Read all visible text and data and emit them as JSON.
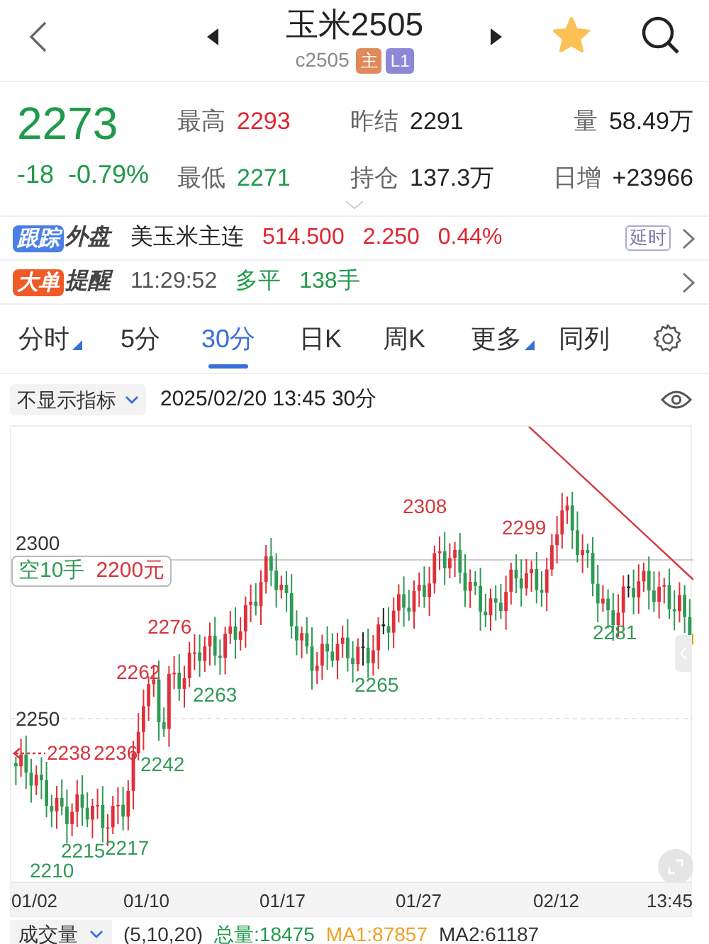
{
  "header": {
    "title": "玉米2505",
    "code": "c2505",
    "badges": [
      {
        "text": "主",
        "color": "#e0895a"
      },
      {
        "text": "L1",
        "color": "#8b89d6"
      }
    ],
    "favorite": true
  },
  "quote": {
    "price": "2273",
    "change": "-18",
    "change_pct": "-0.79%",
    "stats": [
      {
        "label": "最高",
        "value": "2293",
        "color": "#e0242f"
      },
      {
        "label": "昨结",
        "value": "2291",
        "color": "#222222"
      },
      {
        "label": "量",
        "value": "58.49万",
        "color": "#222222"
      },
      {
        "label": "最低",
        "value": "2271",
        "color": "#1f9a4a"
      },
      {
        "label": "持仓",
        "value": "137.3万",
        "color": "#222222"
      },
      {
        "label": "日增",
        "value": "+23966",
        "color": "#222222"
      }
    ]
  },
  "alerts": [
    {
      "tag": {
        "text": "跟踪",
        "color": "#4a7ee8"
      },
      "tag_suffix": "外盘",
      "badge": "延时",
      "items": [
        {
          "text": "美玉米主连",
          "color": "#222222"
        },
        {
          "text": "514.500",
          "color": "#e0242f"
        },
        {
          "text": "2.250",
          "color": "#e0242f"
        },
        {
          "text": "0.44%",
          "color": "#e0242f"
        }
      ]
    },
    {
      "tag": {
        "text": "大单",
        "color": "#f05a28"
      },
      "tag_suffix": "提醒",
      "items": [
        {
          "text": "11:29:52",
          "color": "#555555"
        },
        {
          "text": "多平",
          "color": "#1f9a4a"
        },
        {
          "text": "138手",
          "color": "#1f9a4a"
        }
      ]
    }
  ],
  "tabs": [
    {
      "label": "分时",
      "selected": false,
      "has_menu": true
    },
    {
      "label": "5分",
      "selected": false,
      "has_menu": false
    },
    {
      "label": "30分",
      "selected": true,
      "has_menu": false
    },
    {
      "label": "日K",
      "selected": false,
      "has_menu": false
    },
    {
      "label": "周K",
      "selected": false,
      "has_menu": false
    },
    {
      "label": "更多",
      "selected": false,
      "has_menu": true
    },
    {
      "label": "同列",
      "selected": false,
      "has_menu": false
    }
  ],
  "chart": {
    "indicator": "不显示指标",
    "timestamp": "2025/02/20 13:45 30分",
    "axis_labels": [
      "2300",
      "2250"
    ],
    "position": {
      "side": "空10手",
      "price": "2200元"
    },
    "price_labels": [
      {
        "text": "2308",
        "color": "#d7343c"
      },
      {
        "text": "2299",
        "color": "#d7343c"
      },
      {
        "text": "2276",
        "color": "#d7343c"
      },
      {
        "text": "2262",
        "color": "#d7343c"
      },
      {
        "text": "2263",
        "color": "#2f9a55"
      },
      {
        "text": "2265",
        "color": "#2f9a55"
      },
      {
        "text": "2281",
        "color": "#2f9a55"
      },
      {
        "text": "2238",
        "color": "#d7343c"
      },
      {
        "text": "2236",
        "color": "#d7343c"
      },
      {
        "text": "2242",
        "color": "#2f9a55"
      },
      {
        "text": "2215",
        "color": "#2f9a55"
      },
      {
        "text": "2217",
        "color": "#2f9a55"
      },
      {
        "text": "2210",
        "color": "#2f9a55"
      }
    ],
    "dates": [
      "01/02",
      "01/10",
      "01/17",
      "01/27",
      "02/12",
      "13:45"
    ]
  },
  "volume": {
    "selector": "成交量",
    "params": "(5,10,20)",
    "stats": [
      {
        "text": "总量:18475",
        "color": "#1f9a4a"
      },
      {
        "text": "MA1:87857",
        "color": "#f0a020"
      },
      {
        "text": "MA2:61187",
        "color": "#333333"
      }
    ]
  }
}
